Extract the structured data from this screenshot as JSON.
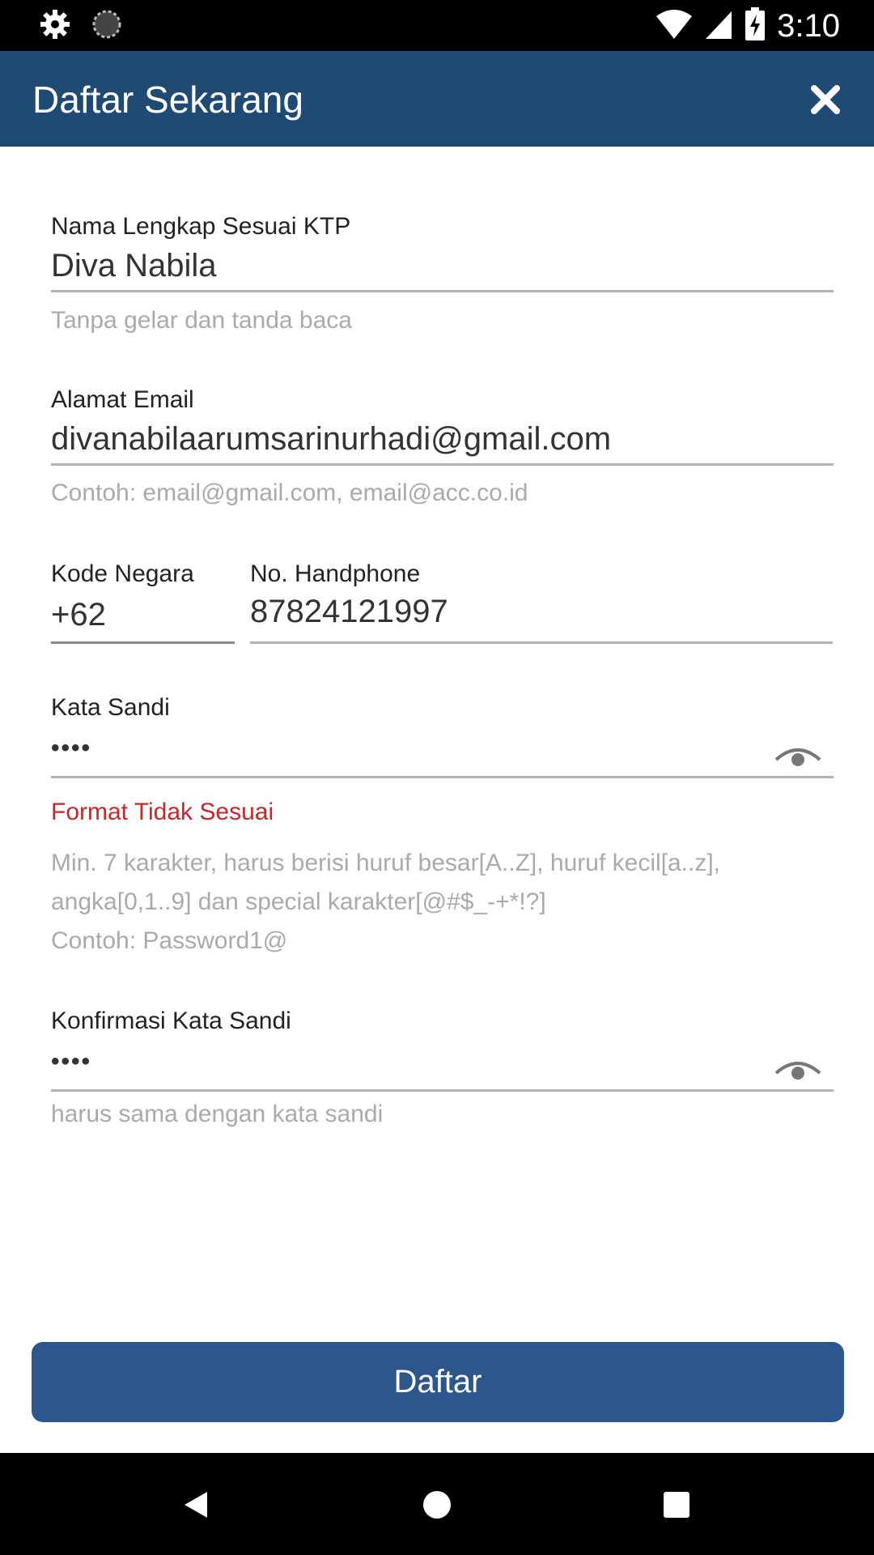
{
  "status_bar": {
    "time": "3:10",
    "icons": [
      "gear-icon",
      "sync-icon",
      "wifi-icon",
      "signal-icon",
      "battery-charging-icon"
    ]
  },
  "app_bar": {
    "title": "Daftar Sekarang",
    "close_icon": "close-icon"
  },
  "form": {
    "full_name": {
      "label": "Nama Lengkap Sesuai KTP",
      "value": "Diva Nabila",
      "helper": "Tanpa gelar dan tanda baca"
    },
    "email": {
      "label": "Alamat Email",
      "value": "divanabilaarumsarinurhadi@gmail.com",
      "helper": "Contoh: email@gmail.com, email@acc.co.id"
    },
    "country_code": {
      "label": "Kode Negara",
      "value": "+62"
    },
    "phone": {
      "label": "No. Handphone",
      "value": "87824121997"
    },
    "password": {
      "label": "Kata Sandi",
      "masked_value": "••••",
      "error": "Format Tidak Sesuai",
      "helper_lines": [
        "Min. 7 karakter, harus berisi huruf besar[A..Z], huruf kecil[a..z],",
        "angka[0,1..9] dan special karakter[@#$_-+*!?]",
        "Contoh: Password1@"
      ]
    },
    "confirm_password": {
      "label": "Konfirmasi Kata Sandi",
      "masked_value": "••••",
      "helper": "harus sama dengan kata sandi"
    }
  },
  "submit_label": "Daftar",
  "nav_bar": {
    "icons": [
      "back-icon",
      "home-icon",
      "recents-icon"
    ]
  },
  "colors": {
    "app_bar": "#1f4a73",
    "button": "#2b578c",
    "error": "#c62828",
    "helper": "#aaaaaa"
  }
}
